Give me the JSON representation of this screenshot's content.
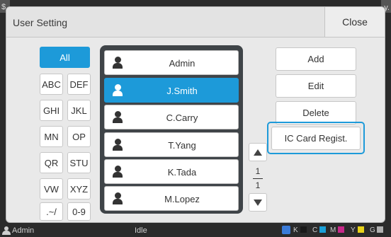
{
  "title": "User Setting",
  "close_label": "Close",
  "index_buttons": [
    "All",
    "ABC",
    "DEF",
    "GHI",
    "JKL",
    "MN",
    "OP",
    "QR",
    "STU",
    "VW",
    "XYZ",
    ".~/",
    "0-9"
  ],
  "users": [
    "Admin",
    "J.Smith",
    "C.Carry",
    "T.Yang",
    "K.Tada",
    "M.Lopez"
  ],
  "selected_user": "J.Smith",
  "page": {
    "current": "1",
    "total": "1"
  },
  "actions": {
    "add": "Add",
    "edit": "Edit",
    "delete": "Delete",
    "ic_card": "IC Card Regist."
  },
  "status": {
    "user": "Admin",
    "state": "Idle",
    "inks": [
      {
        "label": "K",
        "color": "#1a1a1a"
      },
      {
        "label": "C",
        "color": "#1aa0d8"
      },
      {
        "label": "M",
        "color": "#c8288a"
      },
      {
        "label": "Y",
        "color": "#e8d21a"
      },
      {
        "label": "G",
        "color": "#b0b0b0"
      }
    ]
  },
  "colors": {
    "accent": "#1d9ad9"
  }
}
